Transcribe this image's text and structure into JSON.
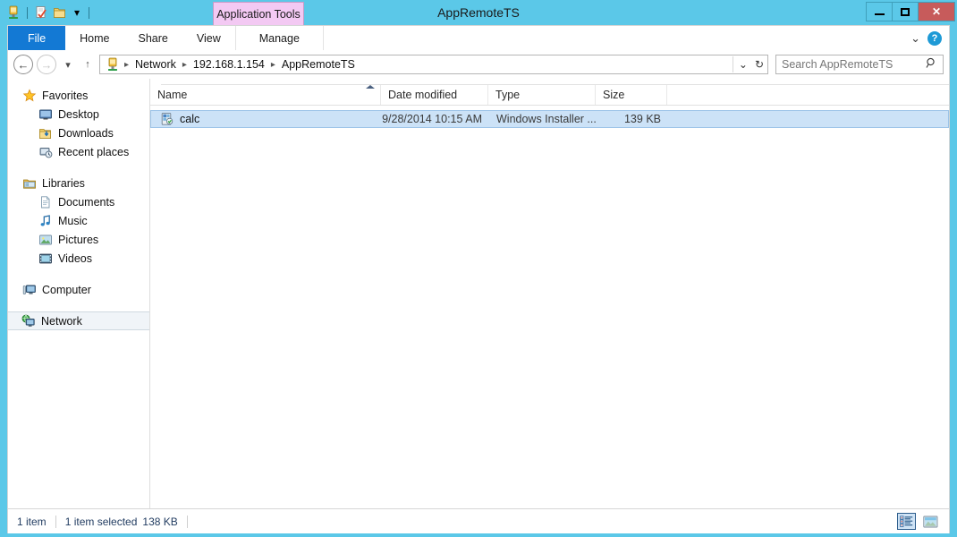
{
  "window": {
    "title": "AppRemoteTS",
    "controls": {
      "minimize": "minimize-button",
      "maximize": "maximize-button",
      "close": "✕"
    }
  },
  "quick_access": {
    "icons": [
      "network-folder-icon",
      "properties-icon",
      "new-folder-icon"
    ],
    "dropdown": "▾"
  },
  "contextual_tab": {
    "label": "Application Tools",
    "color": "#f3c9f3"
  },
  "ribbon": {
    "tabs": [
      {
        "label": "File",
        "active": true
      },
      {
        "label": "Home",
        "active": false
      },
      {
        "label": "Share",
        "active": false
      },
      {
        "label": "View",
        "active": false
      },
      {
        "label": "Manage",
        "active": false,
        "contextual": true
      }
    ],
    "expand": "⌄",
    "help": "?",
    "file_tab_color": "#1379d4"
  },
  "address_bar": {
    "back": "←",
    "forward": "→",
    "recent_dropdown": "▾",
    "up": "↑",
    "breadcrumb_icon": "network-computer-icon",
    "crumbs": [
      "Network",
      "192.168.1.154",
      "AppRemoteTS"
    ],
    "separator": "▸",
    "history_chevron": "⌄",
    "refresh": "↻"
  },
  "search": {
    "placeholder": "Search AppRemoteTS",
    "icon": "search-icon"
  },
  "navigation_pane": {
    "groups": [
      {
        "header": {
          "label": "Favorites",
          "icon": "star-icon"
        },
        "items": [
          {
            "label": "Desktop",
            "icon": "desktop-icon"
          },
          {
            "label": "Downloads",
            "icon": "downloads-icon"
          },
          {
            "label": "Recent places",
            "icon": "recent-places-icon"
          }
        ]
      },
      {
        "header": {
          "label": "Libraries",
          "icon": "libraries-icon"
        },
        "items": [
          {
            "label": "Documents",
            "icon": "documents-icon"
          },
          {
            "label": "Music",
            "icon": "music-icon"
          },
          {
            "label": "Pictures",
            "icon": "pictures-icon"
          },
          {
            "label": "Videos",
            "icon": "videos-icon"
          }
        ]
      },
      {
        "header": {
          "label": "Computer",
          "icon": "computer-icon"
        },
        "items": []
      },
      {
        "header": {
          "label": "Network",
          "icon": "network-icon",
          "selected": true
        },
        "items": []
      }
    ]
  },
  "file_list": {
    "columns": [
      {
        "label": "Name",
        "sorted": true,
        "sort_direction": "ascending"
      },
      {
        "label": "Date modified",
        "sorted": false
      },
      {
        "label": "Type",
        "sorted": false
      },
      {
        "label": "Size",
        "sorted": false
      }
    ],
    "rows": [
      {
        "name": "calc",
        "icon": "windows-installer-icon",
        "date_modified": "9/28/2014 10:15 AM",
        "type": "Windows Installer ...",
        "size": "139 KB",
        "selected": true
      }
    ]
  },
  "status_bar": {
    "item_count": "1 item",
    "selection": "1 item selected",
    "selection_size": "138 KB",
    "view_buttons": [
      {
        "name": "details-view-button",
        "active": true
      },
      {
        "name": "large-icons-view-button",
        "active": false
      }
    ]
  }
}
